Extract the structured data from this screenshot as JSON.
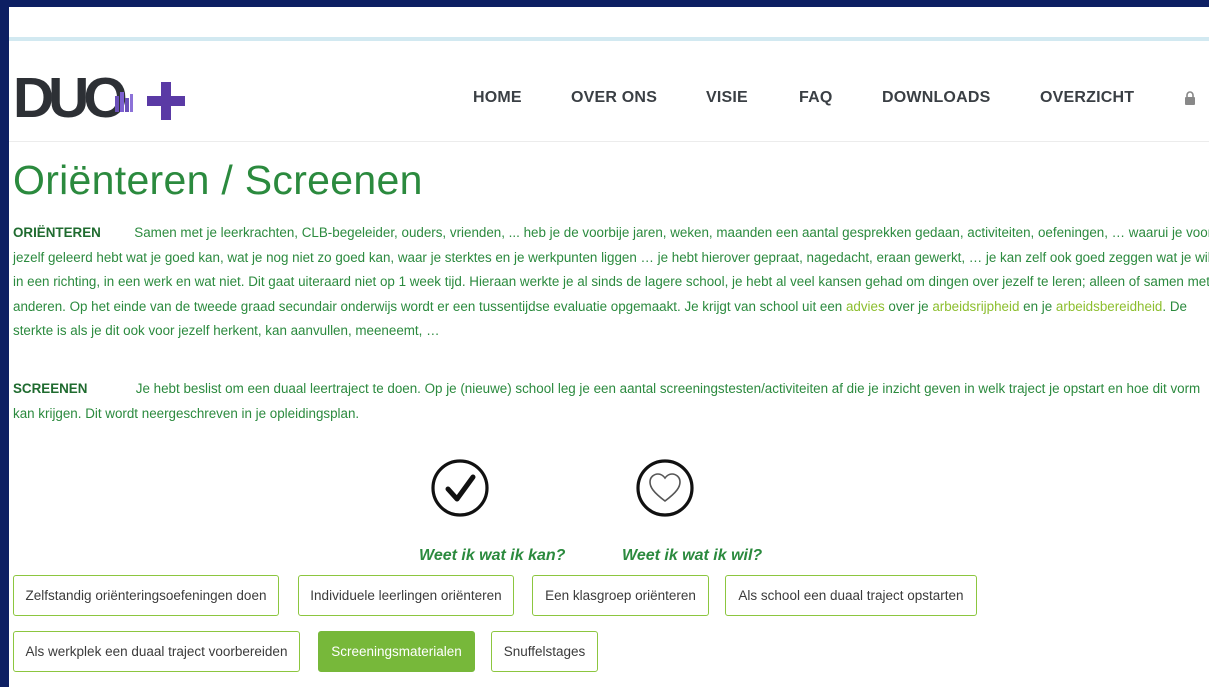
{
  "logo": {
    "text": "DUO",
    "plus": "+"
  },
  "nav": {
    "home": "HOME",
    "over_ons": "OVER ONS",
    "visie": "VISIE",
    "faq": "FAQ",
    "downloads": "DOWNLOADS",
    "overzicht": "OVERZICHT",
    "lock_icon": "lock-icon"
  },
  "page_title": "Oriënteren / Screenen",
  "orienteren": {
    "label": "ORIËNTEREN",
    "text_1": "Samen met je leerkrachten, CLB-begeleider, ouders, vrienden, ... heb je de voorbije jaren, weken, maanden een aantal gesprekken gedaan, activiteiten, oefeningen, … waarui je voor jezelf geleerd hebt wat je goed kan, wat je nog niet zo goed kan, waar je sterktes en je werkpunten liggen … je hebt hierover gepraat, nagedacht, eraan gewerkt, … je kan zelf ook goed zeggen wat je wil in een richting, in een werk en wat niet. Dit gaat uiteraard niet op 1 week tijd. Hieraan werkte je al sinds de lagere school, je hebt al veel kansen gehad om dingen over jezelf te leren; alleen of samen met anderen.  Op het einde van de tweede graad secundair onderwijs wordt er een tussentijdse evaluatie opgemaakt. Je krijgt van school uit een ",
    "link_advies": "advies",
    "text_2": " over je ",
    "link_arbeidsrijpheid": "arbeidsrijpheid",
    "text_3": " en je ",
    "link_arbeidsbereidheid": "arbeidsbereidheid",
    "text_4": ". De sterkte is als je dit ook voor jezelf herkent, kan aanvullen, meeneemt, …"
  },
  "screenen": {
    "label": "SCREENEN",
    "text": "Je hebt beslist om een duaal leertraject te doen. Op je (nieuwe) school leg je een aantal screeningstesten/activiteiten af die je inzicht geven in welk traject je opstart en hoe dit vorm kan krijgen. Dit wordt neergeschreven in je opleidingsplan."
  },
  "icons": {
    "check": "checkmark-icon",
    "heart": "heart-icon"
  },
  "questions": {
    "kan": "Weet ik wat ik kan?",
    "wil": "Weet ik wat ik wil?"
  },
  "buttons": {
    "zelfstandig": "Zelfstandig oriënteringsoefeningen doen",
    "individuele": "Individuele leerlingen oriënteren",
    "klasgroep": "Een klasgroep oriënteren",
    "school": "Als school een duaal traject opstarten",
    "werkplek": "Als werkplek een duaal traject voorbereiden",
    "screeningsmaterialen": "Screeningsmaterialen",
    "snuffelstages": "Snuffelstages"
  },
  "colors": {
    "green": "#2b8a3e",
    "accent": "#77b83a",
    "link": "#8cbe2d",
    "brand_purple": "#5a3aa5"
  }
}
